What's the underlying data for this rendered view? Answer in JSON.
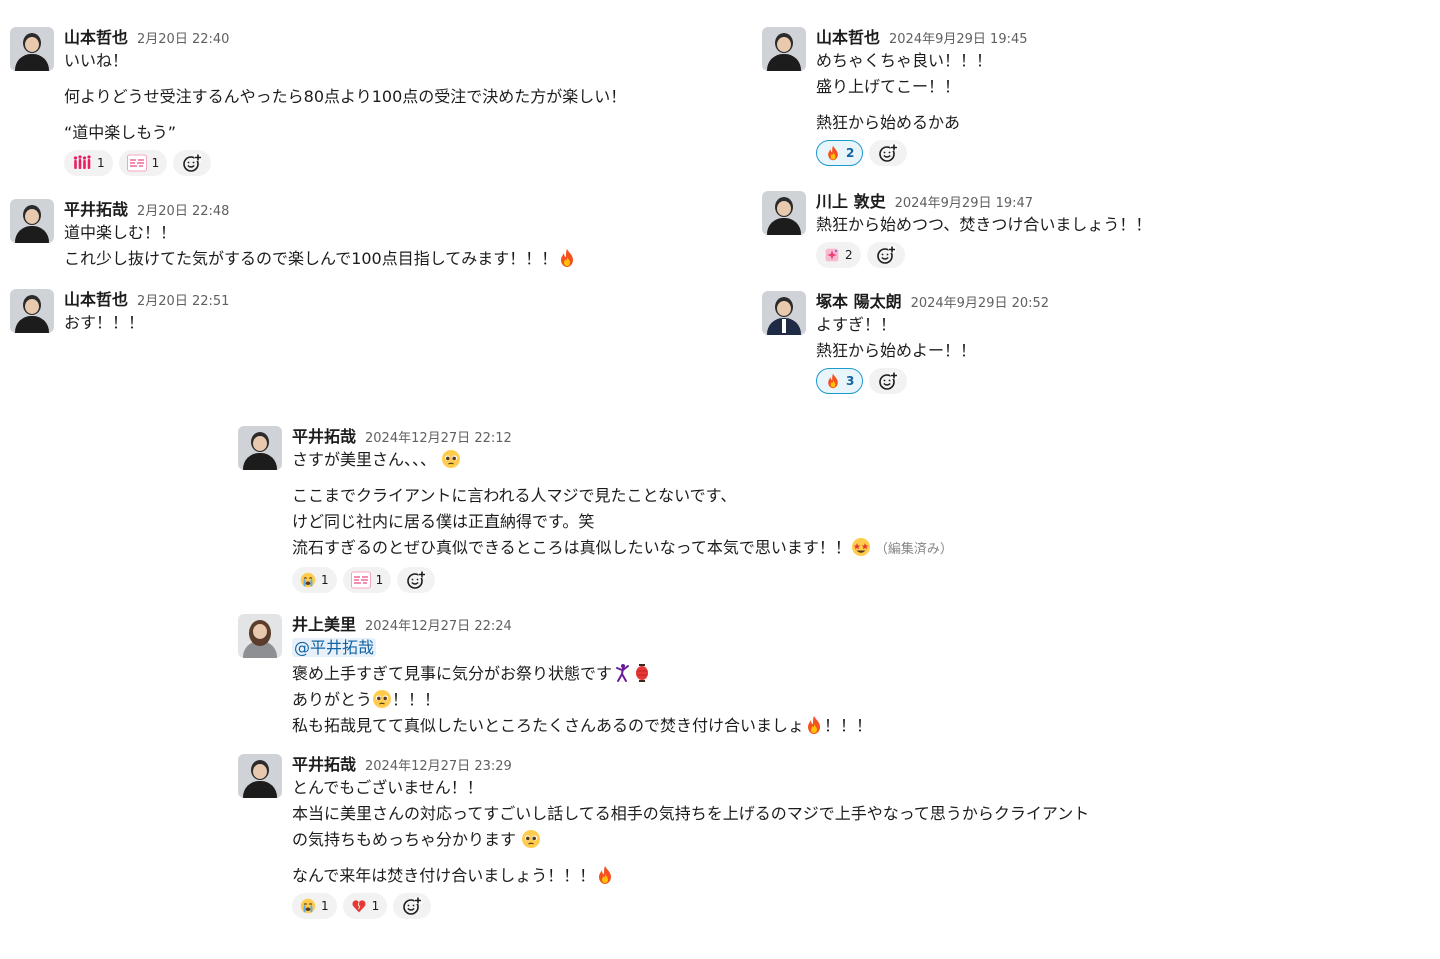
{
  "left_panel": {
    "messages": [
      {
        "name": "山本哲也",
        "time": "2月20日 22:40",
        "lines": [
          "いいね！"
        ],
        "lines2": [
          "何よりどうせ受注するんやったら80点より100点の受注で決めた方が楽しい！"
        ],
        "lines3": [
          "“道中楽しもう”"
        ],
        "reactions": [
          {
            "emoji": "crowd",
            "count": "1"
          },
          {
            "emoji": "label",
            "count": "1"
          }
        ]
      },
      {
        "name": "平井拓哉",
        "time": "2月20日 22:48",
        "lines": [
          "道中楽しむ！！",
          "これ少し抜けてた気がするので楽しんで100点目指してみます！！！"
        ]
      },
      {
        "name": "山本哲也",
        "time": "2月20日 22:51",
        "lines": [
          "おす！！！"
        ]
      }
    ]
  },
  "right_panel": {
    "messages": [
      {
        "name": "山本哲也",
        "time": "2024年9月29日 19:45",
        "lines": [
          "めちゃくちゃ良い！！！",
          "盛り上げてこー！！"
        ],
        "lines2": [
          "熱狂から始めるかあ"
        ],
        "reactions": [
          {
            "emoji": "fire",
            "count": "2",
            "active": true
          }
        ]
      },
      {
        "name": "川上 敦史",
        "time": "2024年9月29日 19:47",
        "lines": [
          "熱狂から始めつつ、焚きつけ合いましょう！！"
        ],
        "reactions": [
          {
            "emoji": "sparkle",
            "count": "2"
          }
        ]
      },
      {
        "name": "塚本 陽太朗",
        "time": "2024年9月29日 20:52",
        "lines": [
          "よすぎ！！",
          "熱狂から始めよー！！"
        ],
        "reactions": [
          {
            "emoji": "fire",
            "count": "3",
            "active": true
          }
        ]
      }
    ]
  },
  "center_panel": {
    "messages": [
      {
        "name": "平井拓哉",
        "time": "2024年12月27日 22:12",
        "lines": [
          "さすが美里さん、、、"
        ],
        "lines2": [
          "ここまでクライアントに言われる人マジで見たことないです、",
          "けど同じ社内に居る僕は正直納得です。笑",
          "流石すぎるのとぜひ真似できるところは真似したいなって本気で思います！！"
        ],
        "edited": "（編集済み）",
        "reactions": [
          {
            "emoji": "cry",
            "count": "1"
          },
          {
            "emoji": "label",
            "count": "1"
          }
        ]
      },
      {
        "name": "井上美里",
        "time": "2024年12月27日 22:24",
        "mention": "@平井拓哉",
        "lines": [
          "褒め上手すぎて見事に気分がお祭り状態です",
          "ありがとう",
          "！！！",
          "私も拓哉見てて真似したいところたくさんあるので焚き付け合いましょ",
          "！！！"
        ]
      },
      {
        "name": "平井拓哉",
        "time": "2024年12月27日 23:29",
        "lines": [
          "とんでもございません！！",
          "本当に美里さんの対応ってすごいし話してる相手の気持ちを上げるのマジで上手やなって思うからクライアント",
          "の気持ちもめっちゃ分かります"
        ],
        "lines2": [
          "なんで来年は焚き付け合いましょう！！！"
        ],
        "reactions": [
          {
            "emoji": "cry",
            "count": "1"
          },
          {
            "emoji": "heart",
            "count": "1"
          }
        ]
      }
    ]
  },
  "icons": {
    "add_reaction": "add-reaction-icon",
    "fire": "fire-emoji",
    "pleading": "pleading-face-emoji",
    "star_struck": "star-struck-emoji",
    "lantern": "lantern-emoji",
    "dancer": "dancer-emoji"
  },
  "colors": {
    "active_reaction_border": "#1d9bd1",
    "active_reaction_bg": "#e8f5fa",
    "mention_text": "#1264a3",
    "timestamp": "#616061"
  }
}
